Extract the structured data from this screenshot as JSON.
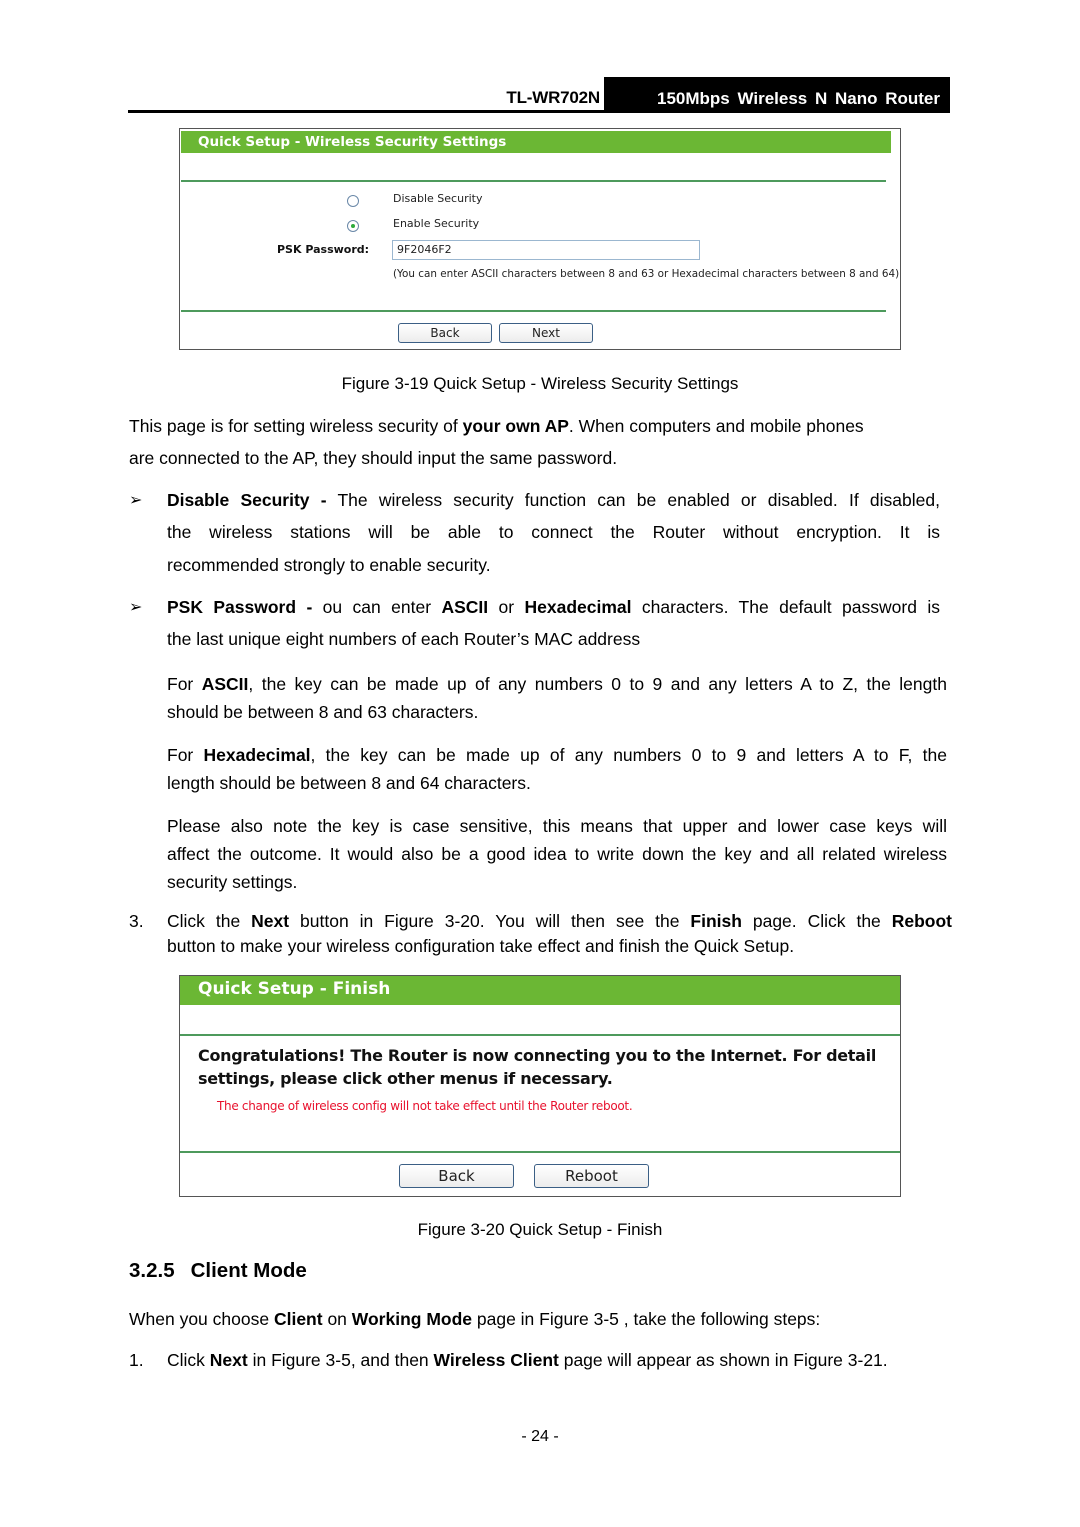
{
  "header": {
    "model": "TL-WR702N",
    "product": "150Mbps Wireless N Nano Router"
  },
  "figure_19": {
    "panel_title": "Quick Setup - Wireless Security Settings",
    "options": [
      {
        "label": "Disable Security",
        "selected": false
      },
      {
        "label": "Enable Security",
        "selected": true
      }
    ],
    "psk_label": "PSK Password:",
    "psk_value": "9F2046F2",
    "psk_hint": "(You can enter ASCII characters between 8 and 63 or Hexadecimal characters between 8 and 64)",
    "back_label": "Back",
    "next_label": "Next",
    "caption": "Figure 3-19 Quick Setup - Wireless Security Settings",
    "accent_color": "#6bb734"
  },
  "body": {
    "intro_1a": "This page is for setting wireless security of ",
    "intro_1b": "your own AP",
    "intro_1c": ". When computers and mobile phones",
    "intro_2": "are connected to the AP, they should input the same password.",
    "bullet_glyph": "➢",
    "disable_term": "Disable Security -",
    "disable_line1": " The wireless security function can be enabled or disabled. If disabled,",
    "disable_line2": "the wireless stations will be able to connect the Router without encryption. It is",
    "disable_line3": "recommended strongly to enable security.",
    "psk_term": "PSK Password -",
    "psk_1a": " ou can enter ",
    "psk_1b": "ASCII",
    "psk_1c": " or ",
    "psk_1d": "Hexadecimal",
    "psk_1e": " characters. The default password is",
    "psk_line2": "the last unique eight numbers of each Router’s MAC address",
    "ascii_a": "For ",
    "ascii_b": "ASCII",
    "ascii_c": ", the key can be made up of any numbers 0 to 9 and any letters A to Z, the length",
    "ascii_line2": "should be between 8 and 63 characters.",
    "hex_a": "For ",
    "hex_b": "Hexadecimal",
    "hex_c": ", the key can be made up of any numbers 0 to 9 and letters A to F, the",
    "hex_line2": "length should be between 8 and 64 characters.",
    "note_line1": "Please also note the key is case sensitive, this means that upper and lower case keys will",
    "note_line2": "affect the outcome. It would also be a good idea to write down the key and all related wireless",
    "note_line3": "security settings.",
    "step3_num": "3.",
    "step3_a": "Click the ",
    "step3_b": "Next",
    "step3_c": " button in Figure 3-20. You will then see the ",
    "step3_d": "Finish",
    "step3_e": " page. Click the ",
    "step3_f": "Reboot",
    "step3_line2": "button to make your wireless configuration take effect and finish the Quick Setup."
  },
  "figure_20": {
    "panel_title": "Quick Setup - Finish",
    "congrats_line1": "Congratulations! The Router is now connecting you to the Internet. For detail",
    "congrats_line2": "settings, please click other menus if necessary.",
    "warning": "The change of wireless config will not take effect until the Router reboot.",
    "warning_color": "#e8112d",
    "back_label": "Back",
    "reboot_label": "Reboot",
    "caption": "Figure 3-20 Quick Setup - Finish"
  },
  "section": {
    "number": "3.2.5",
    "title": "Client Mode",
    "intro_a": "When you choose ",
    "intro_b": "Client",
    "intro_c": " on ",
    "intro_d": "Working Mode",
    "intro_e": " page in Figure 3-5 , take the following steps:",
    "step1_num": "1.",
    "step1_a": "Click ",
    "step1_b": "Next",
    "step1_c": " in Figure 3-5, and then ",
    "step1_d": "Wireless Client",
    "step1_e": " page will appear as shown in Figure 3-21."
  },
  "footer": {
    "page_number": "- 24 -"
  }
}
